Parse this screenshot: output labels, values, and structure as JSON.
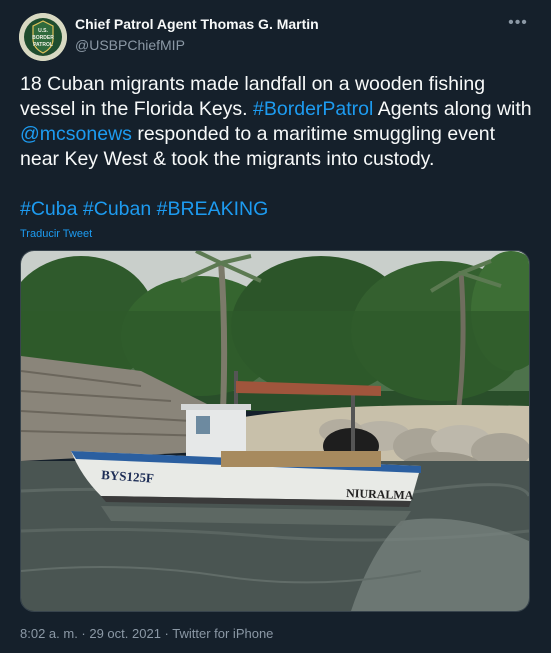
{
  "author": {
    "display_name": "Chief Patrol Agent Thomas G. Martin",
    "handle": "@USBPChiefMIP",
    "avatar_text": "U.S. BORDER PATROL"
  },
  "tweet": {
    "text_1": "18 Cuban migrants made landfall on a wooden fishing vessel in the Florida Keys. ",
    "mention_1": "#BorderPatrol",
    "text_2": " Agents along with ",
    "mention_2": "@mcsonews",
    "text_3": " responded to a maritime smuggling event near Key West & took the migrants into custody.",
    "hashtags": [
      "#Cuba",
      "#Cuban",
      "#BREAKING"
    ],
    "translate_label": "Traducir Tweet"
  },
  "photo": {
    "boat_registration": "BYS125F",
    "boat_name": "NIURALMA"
  },
  "meta": {
    "timestamp": "8:02 a. m. · 29 oct. 2021 · ",
    "source": "Twitter for iPhone"
  },
  "colors": {
    "background": "#15202b",
    "link": "#1d9bf0",
    "secondary_text": "#8b98a5"
  },
  "icons": [
    "more-options-icon"
  ]
}
